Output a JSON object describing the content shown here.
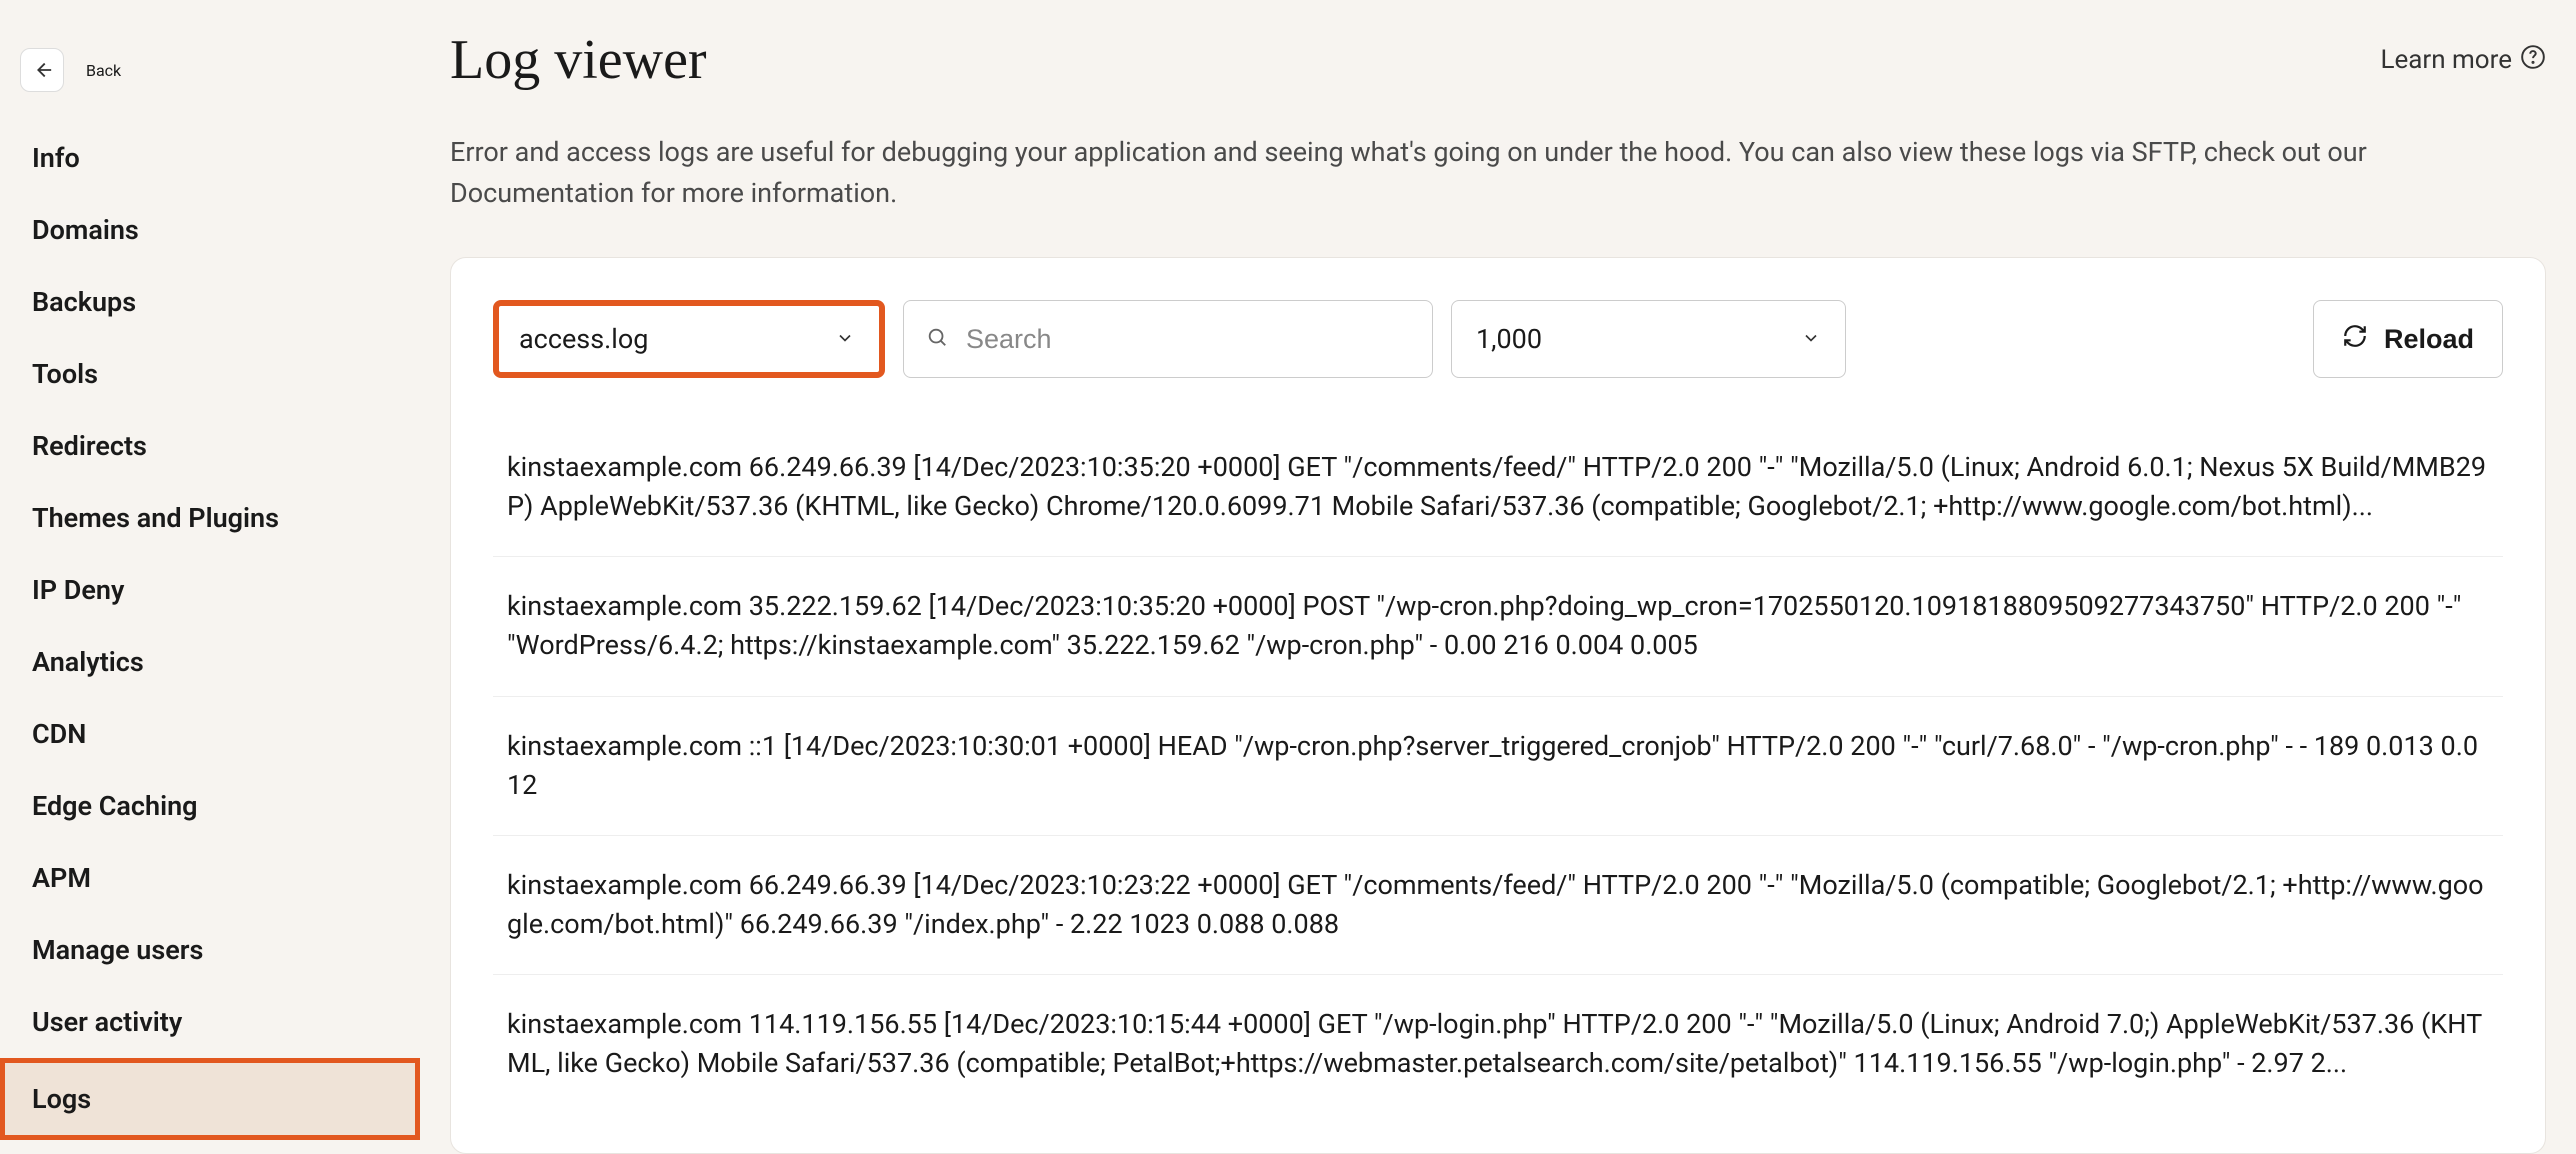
{
  "sidebar": {
    "back_label": "Back",
    "items": [
      {
        "label": "Info",
        "name": "nav-info"
      },
      {
        "label": "Domains",
        "name": "nav-domains"
      },
      {
        "label": "Backups",
        "name": "nav-backups"
      },
      {
        "label": "Tools",
        "name": "nav-tools"
      },
      {
        "label": "Redirects",
        "name": "nav-redirects"
      },
      {
        "label": "Themes and Plugins",
        "name": "nav-themes-plugins"
      },
      {
        "label": "IP Deny",
        "name": "nav-ip-deny"
      },
      {
        "label": "Analytics",
        "name": "nav-analytics"
      },
      {
        "label": "CDN",
        "name": "nav-cdn"
      },
      {
        "label": "Edge Caching",
        "name": "nav-edge-caching"
      },
      {
        "label": "APM",
        "name": "nav-apm"
      },
      {
        "label": "Manage users",
        "name": "nav-manage-users"
      },
      {
        "label": "User activity",
        "name": "nav-user-activity"
      },
      {
        "label": "Logs",
        "name": "nav-logs",
        "active": true
      }
    ]
  },
  "header": {
    "title": "Log viewer",
    "learn_more": "Learn more"
  },
  "description": "Error and access logs are useful for debugging your application and seeing what's going on under the hood. You can also view these logs via SFTP, check out our Documentation for more information.",
  "controls": {
    "log_select": "access.log",
    "search_placeholder": "Search",
    "count_select": "1,000",
    "reload_label": "Reload"
  },
  "logs": [
    "kinstaexample.com 66.249.66.39 [14/Dec/2023:10:35:20 +0000] GET \"/comments/feed/\" HTTP/2.0 200 \"-\" \"Mozilla/5.0 (Linux; Android 6.0.1; Nexus 5X Build/MMB29P) AppleWebKit/537.36 (KHTML, like Gecko) Chrome/120.0.6099.71 Mobile Safari/537.36 (compatible; Googlebot/2.1; +http://www.google.com/bot.html)...",
    "kinstaexample.com 35.222.159.62 [14/Dec/2023:10:35:20 +0000] POST \"/wp-cron.php?doing_wp_cron=1702550120.1091818809509277343750\" HTTP/2.0 200 \"-\" \"WordPress/6.4.2; https://kinstaexample.com\" 35.222.159.62 \"/wp-cron.php\" - 0.00 216 0.004 0.005",
    "kinstaexample.com ::1 [14/Dec/2023:10:30:01 +0000] HEAD \"/wp-cron.php?server_triggered_cronjob\" HTTP/2.0 200 \"-\" \"curl/7.68.0\" - \"/wp-cron.php\" - - 189 0.013 0.012",
    "kinstaexample.com 66.249.66.39 [14/Dec/2023:10:23:22 +0000] GET \"/comments/feed/\" HTTP/2.0 200 \"-\" \"Mozilla/5.0 (compatible; Googlebot/2.1; +http://www.google.com/bot.html)\" 66.249.66.39 \"/index.php\" - 2.22 1023 0.088 0.088",
    "kinstaexample.com 114.119.156.55 [14/Dec/2023:10:15:44 +0000] GET \"/wp-login.php\" HTTP/2.0 200 \"-\" \"Mozilla/5.0 (Linux; Android 7.0;) AppleWebKit/537.36 (KHTML, like Gecko) Mobile Safari/537.36 (compatible; PetalBot;+https://webmaster.petalsearch.com/site/petalbot)\" 114.119.156.55 \"/wp-login.php\" - 2.97 2..."
  ]
}
